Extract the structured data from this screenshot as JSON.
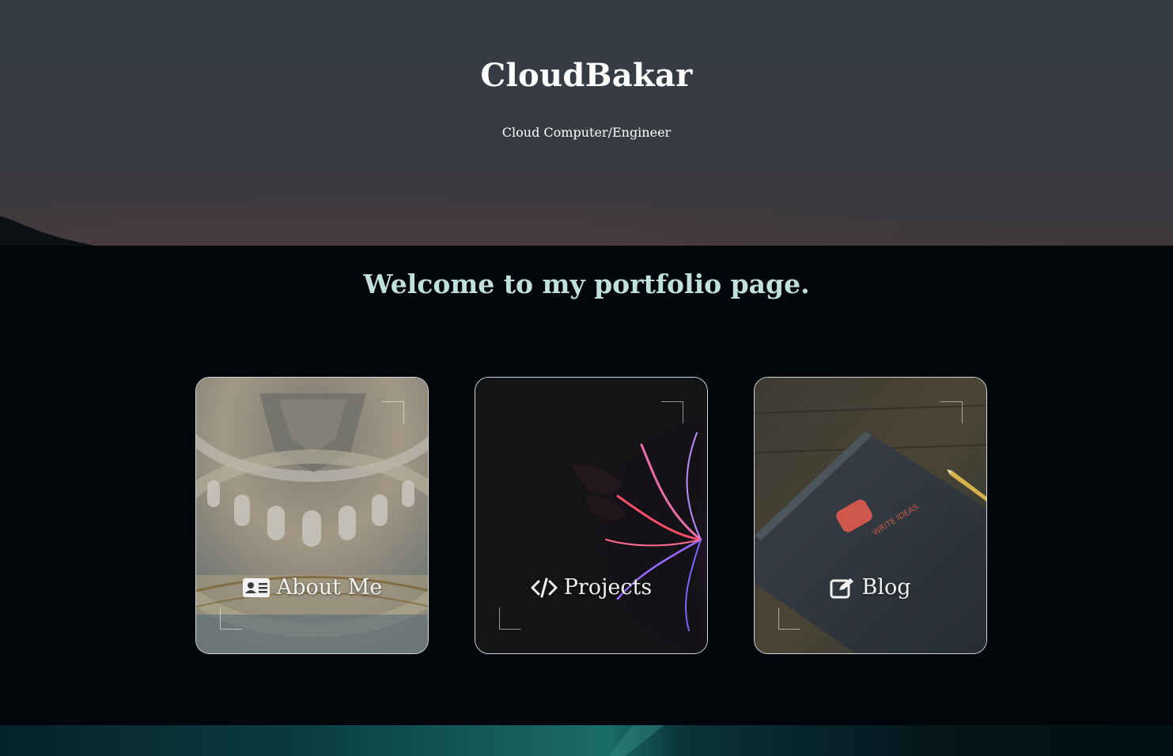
{
  "header": {
    "title": "CloudBakar",
    "subtitle": "Cloud Computer/Engineer"
  },
  "main": {
    "welcome": "Welcome to my portfolio page."
  },
  "cards": [
    {
      "label": "About Me",
      "icon": "id-card-icon"
    },
    {
      "label": "Projects",
      "icon": "code-icon"
    },
    {
      "label": "Blog",
      "icon": "edit-icon"
    }
  ],
  "colors": {
    "page_background": "#02060b",
    "welcome_text": "#bfe0dc",
    "card_border": "#d6dadd",
    "accent_teal": "#1a6e67"
  }
}
